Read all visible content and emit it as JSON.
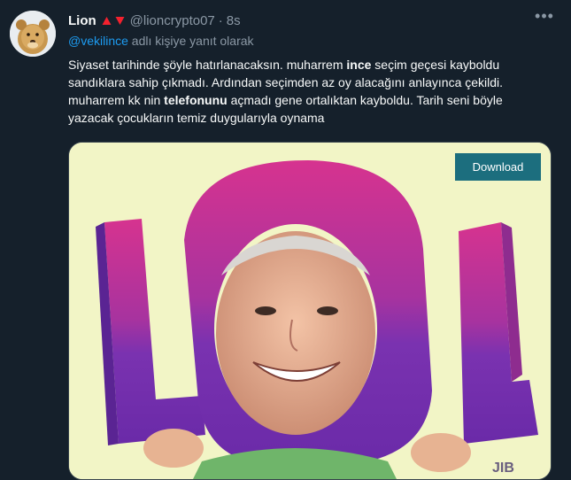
{
  "tweet": {
    "author_name": "Lion",
    "handle": "@lioncrypto07",
    "separator": "·",
    "time": "8s",
    "reply_prefix_mention": "@vekilince",
    "reply_suffix": " adlı kişiye yanıt olarak",
    "text_parts": [
      "Siyaset tarihinde şöyle hatırlanacaksın. muharrem ",
      "ince",
      " seçim geçesi kayboldu sandıklara sahip çıkmadı. Ardından seçimden az oy alacağını anlayınca çekildi. muharrem kk nin ",
      "telefonunu",
      " açmadı gene ortalıktan kayboldu. Tarih seni böyle yazacak çocukların temiz duygularıyla oynama"
    ],
    "more_icon": "more-horizontal-icon",
    "up_triangle_color": "#f4212e",
    "down_triangle_color": "#f4212e"
  },
  "media": {
    "download_label": "Download",
    "image_subject": "LOL meme",
    "watermark": "JIB"
  }
}
